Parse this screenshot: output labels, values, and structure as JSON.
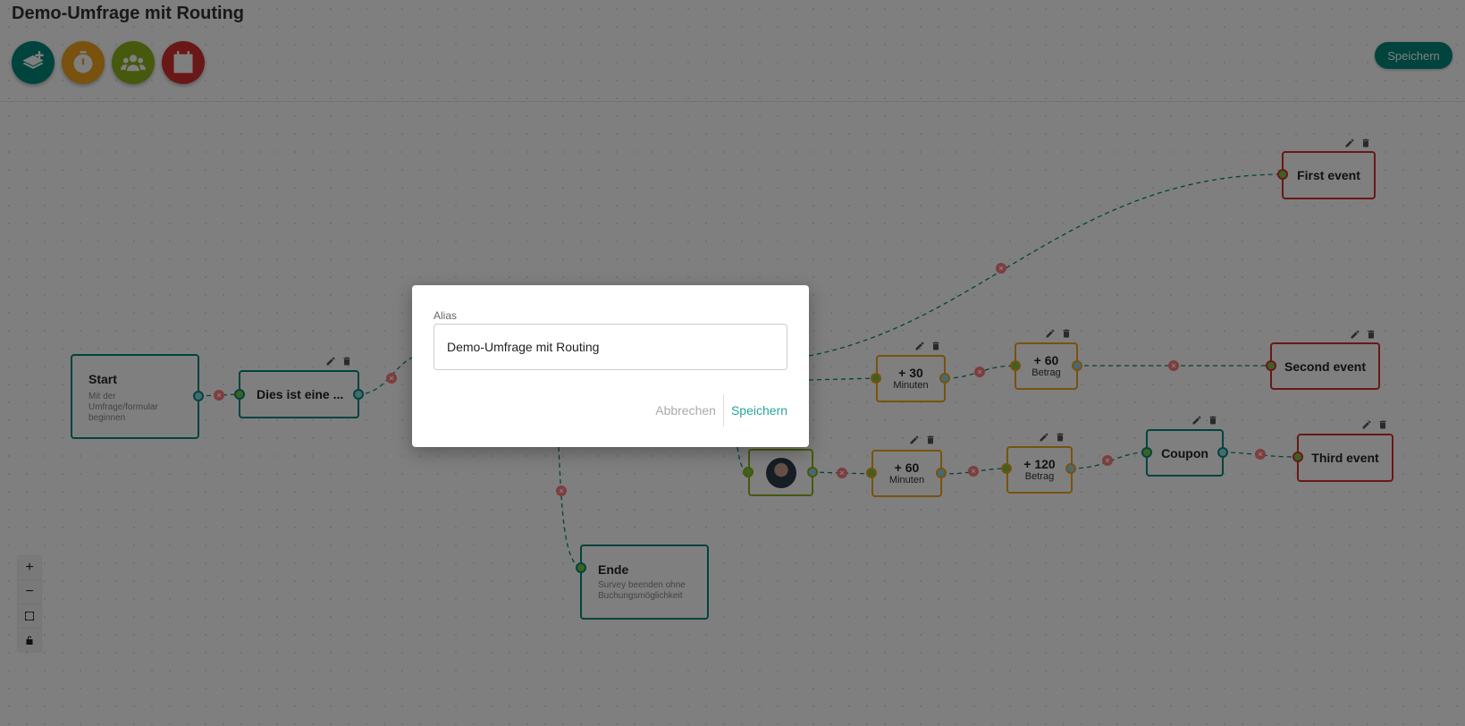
{
  "header": {
    "title": "Demo-Umfrage mit Routing",
    "save_label": "Speichern",
    "tools": [
      {
        "name": "add-page",
        "icon": "layers-plus-icon",
        "color": "#00897b"
      },
      {
        "name": "timer",
        "icon": "stopwatch-icon",
        "color": "#f0a51d"
      },
      {
        "name": "users",
        "icon": "users-icon",
        "color": "#8cb31b"
      },
      {
        "name": "calendar",
        "icon": "calendar-icon",
        "color": "#d32f2f"
      }
    ]
  },
  "nodes": {
    "start": {
      "title": "Start",
      "subtitle": "Mit der Umfrage/formular beginnen"
    },
    "question": {
      "title": "Dies ist eine ..."
    },
    "ende": {
      "title": "Ende",
      "subtitle": "Survey beenden ohne Buchungsmöglichkeit"
    },
    "wait30": {
      "value": "+ 30",
      "unit": "Minuten"
    },
    "amount60": {
      "value": "+ 60",
      "unit": "Betrag"
    },
    "wait60": {
      "value": "+ 60",
      "unit": "Minuten"
    },
    "amount120": {
      "value": "+ 120",
      "unit": "Betrag"
    },
    "coupon": {
      "title": "Coupon"
    },
    "first_event": {
      "title": "First event"
    },
    "second_event": {
      "title": "Second event"
    },
    "third_event": {
      "title": "Third event"
    }
  },
  "zoom_controls": {
    "zoom_in": "+",
    "zoom_out": "−",
    "fit": "⛶",
    "lock": "🔓"
  },
  "dialog": {
    "label": "Alias",
    "value": "Demo-Umfrage mit Routing",
    "cancel_label": "Abbrechen",
    "save_label": "Speichern"
  }
}
